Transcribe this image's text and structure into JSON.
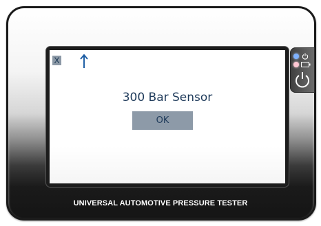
{
  "device": {
    "brand_label": "UNIVERSAL AUTOMOTIVE PRESSURE TESTER"
  },
  "screen": {
    "close_label": "X",
    "up_icon": "up-arrow-icon",
    "message": "300 Bar Sensor",
    "ok_label": "OK"
  },
  "side_panel": {
    "status_icon": "power-status-icon",
    "battery_icon": "battery-icon",
    "power_icon": "power-icon",
    "status_led_color": "#7fb2ff",
    "battery_led_color": "#ffc7d3"
  },
  "colors": {
    "text_blue": "#1e3a5a",
    "button_gray": "#8d9aa8",
    "arrow_blue": "#1f5fa5"
  }
}
